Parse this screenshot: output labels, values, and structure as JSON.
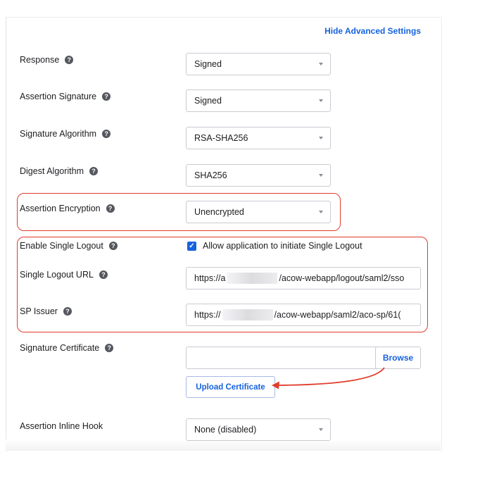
{
  "header": {
    "advanced_link": "Hide Advanced Settings"
  },
  "fields": {
    "response": {
      "label": "Response",
      "value": "Signed"
    },
    "assertion_signature": {
      "label": "Assertion Signature",
      "value": "Signed"
    },
    "signature_algorithm": {
      "label": "Signature Algorithm",
      "value": "RSA-SHA256"
    },
    "digest_algorithm": {
      "label": "Digest Algorithm",
      "value": "SHA256"
    },
    "assertion_encryption": {
      "label": "Assertion Encryption",
      "value": "Unencrypted"
    },
    "single_logout": {
      "label": "Enable Single Logout",
      "checkbox_label": "Allow application to initiate Single Logout",
      "checked": true
    },
    "single_logout_url": {
      "label": "Single Logout URL",
      "value_prefix": "https://a",
      "value_suffix": "/acow-webapp/logout/saml2/sso"
    },
    "sp_issuer": {
      "label": "SP Issuer",
      "value_prefix": "https://",
      "value_suffix": "/acow-webapp/saml2/aco-sp/61("
    },
    "signature_certificate": {
      "label": "Signature Certificate",
      "browse_label": "Browse",
      "upload_label": "Upload Certificate"
    },
    "assertion_inline_hook": {
      "label": "Assertion Inline Hook",
      "value": "None (disabled)"
    }
  },
  "colors": {
    "accent": "#1662dd",
    "highlight": "#e03c2c",
    "help_icon": "#55575f"
  },
  "icons": {
    "help": "question-circle-icon",
    "caret": "caret-down-icon",
    "check": "checkmark-icon"
  }
}
